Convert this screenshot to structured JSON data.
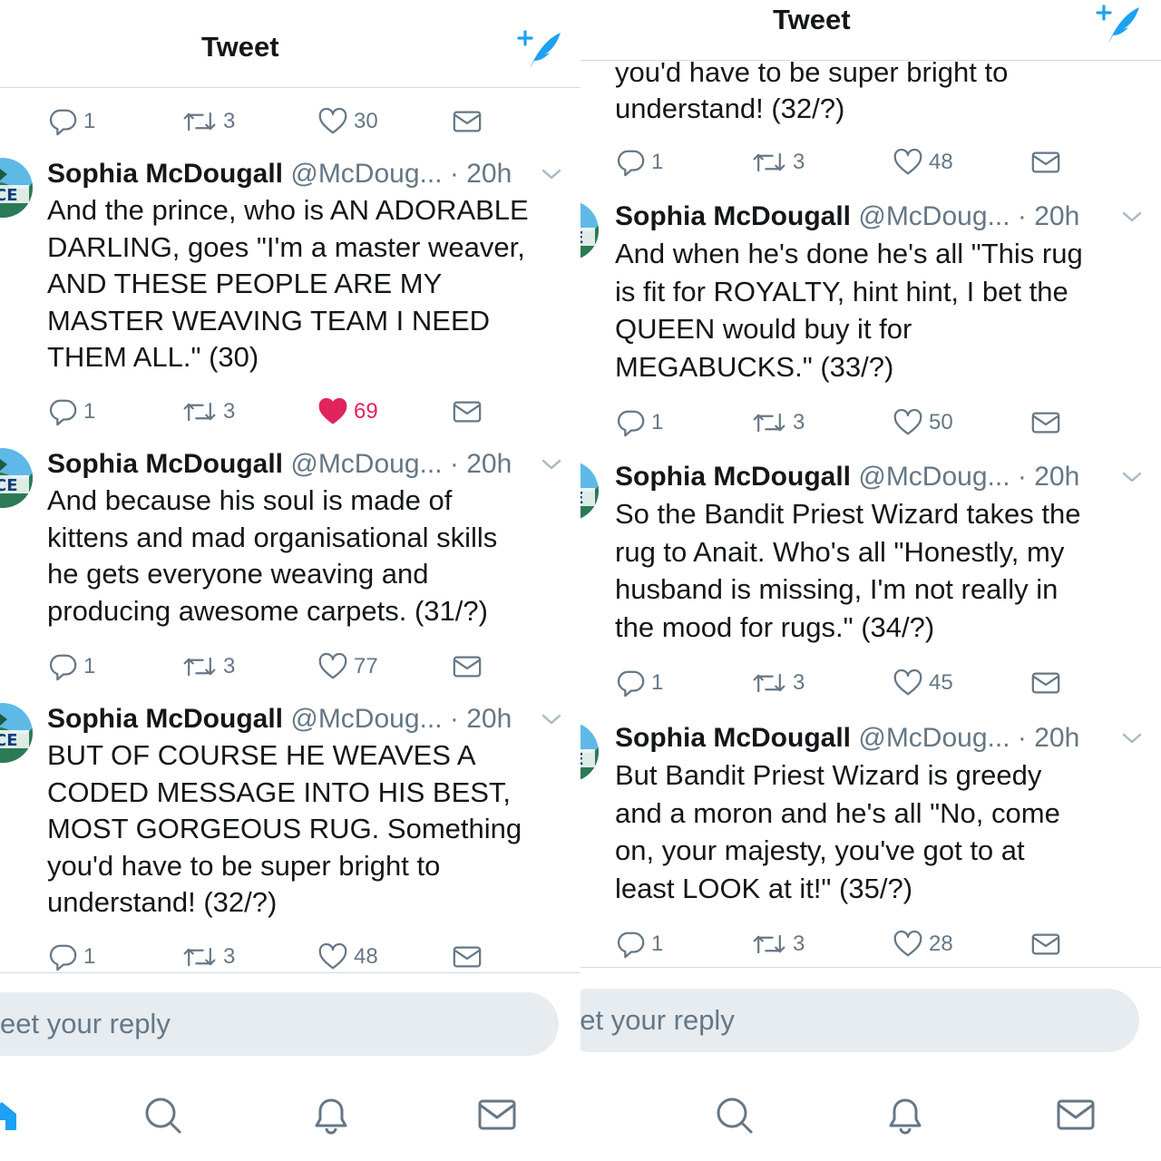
{
  "left": {
    "header": {
      "title": "Tweet"
    },
    "top_action_bar": {
      "reply_count": "1",
      "retweet_count": "3",
      "like_count": "30"
    },
    "tweets": [
      {
        "name": "Sophia McDougall",
        "handle": "@McDoug...",
        "time": "· 20h",
        "text": "And the prince, who is AN ADORABLE\nDARLING, goes \"I'm a master weaver,\nAND THESE PEOPLE ARE MY\nMASTER WEAVING TEAM I NEED\nTHEM ALL.\" (30)",
        "reply_count": "1",
        "retweet_count": "3",
        "like_count": "69",
        "liked": true
      },
      {
        "name": "Sophia McDougall",
        "handle": "@McDoug...",
        "time": "· 20h",
        "text": "And because his soul is made of\nkittens and mad organisational skills\nhe gets everyone weaving and\nproducing awesome carpets. (31/?)",
        "reply_count": "1",
        "retweet_count": "3",
        "like_count": "77",
        "liked": false
      },
      {
        "name": "Sophia McDougall",
        "handle": "@McDoug...",
        "time": "· 20h",
        "text": "BUT OF COURSE HE WEAVES A\nCODED MESSAGE INTO HIS BEST,\nMOST GORGEOUS RUG. Something\nyou'd have to be super bright to\nunderstand! (32/?)",
        "reply_count": "1",
        "retweet_count": "3",
        "like_count": "48",
        "liked": false
      }
    ],
    "reply_placeholder": "eet your reply"
  },
  "right": {
    "header": {
      "title": "Tweet"
    },
    "cutoff_text": "you'd have to be super bright to\nunderstand! (32/?)",
    "top_action_bar": {
      "reply_count": "1",
      "retweet_count": "3",
      "like_count": "48"
    },
    "tweets": [
      {
        "name": "Sophia McDougall",
        "handle": "@McDoug...",
        "time": "· 20h",
        "text": "And when he's done he's all \"This rug\nis fit for ROYALTY, hint hint, I bet the\nQUEEN would buy it for\nMEGABUCKS.\" (33/?)",
        "reply_count": "1",
        "retweet_count": "3",
        "like_count": "50",
        "liked": false
      },
      {
        "name": "Sophia McDougall",
        "handle": "@McDoug...",
        "time": "· 20h",
        "text": "So the Bandit Priest Wizard takes the\nrug to Anait. Who's all \"Honestly, my\nhusband is missing, I'm not really in\nthe mood for rugs.\" (34/?)",
        "reply_count": "1",
        "retweet_count": "3",
        "like_count": "45",
        "liked": false
      },
      {
        "name": "Sophia McDougall",
        "handle": "@McDoug...",
        "time": "· 20h",
        "text": "But Bandit Priest Wizard is greedy\nand a moron and he's all \"No, come\non, your majesty, you've got to at\nleast LOOK at it!\" (35/?)",
        "reply_count": "1",
        "retweet_count": "3",
        "like_count": "28",
        "liked": false
      }
    ],
    "reply_placeholder": "eet your reply"
  },
  "icons": [
    "compose-tweet-icon",
    "reply-icon",
    "retweet-icon",
    "like-icon",
    "direct-message-icon",
    "home-icon",
    "search-icon",
    "notifications-icon",
    "messages-icon",
    "chevron-down-icon",
    "avatar"
  ],
  "colors": {
    "accent": "#1da1f2",
    "like": "#e0245e",
    "icon_gray": "#657786",
    "text": "#14171a",
    "reply_bg": "#e6ecf0",
    "divider": "#d6d9dc"
  }
}
